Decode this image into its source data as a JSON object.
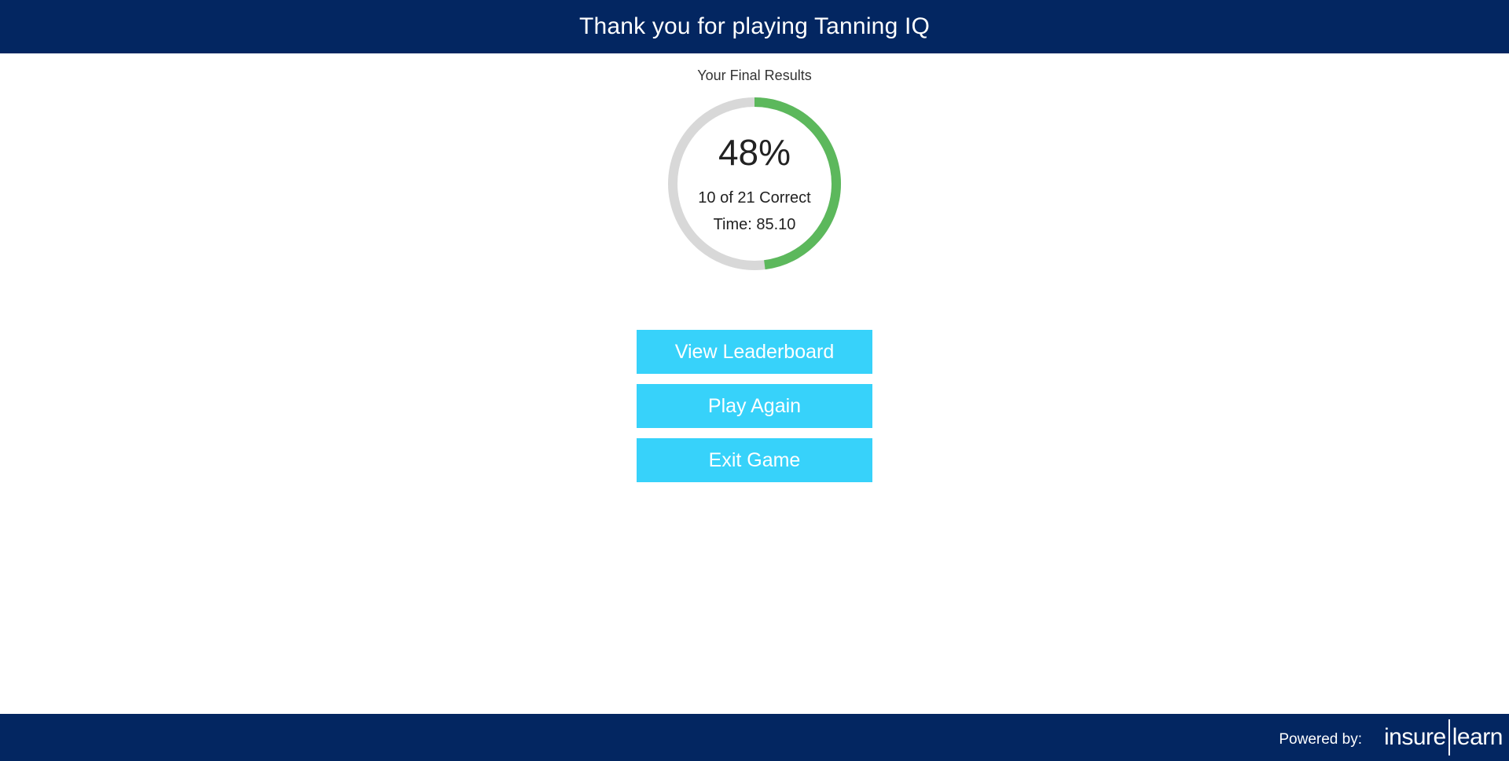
{
  "header": {
    "title": "Thank you for playing Tanning IQ"
  },
  "results": {
    "label": "Your Final Results",
    "percent_text": "48%",
    "progress_fraction": 0.48,
    "correct_text": "10 of 21 Correct",
    "time_text": "Time: 85.10"
  },
  "actions": {
    "leaderboard_label": "View Leaderboard",
    "play_again_label": "Play Again",
    "exit_label": "Exit Game"
  },
  "footer": {
    "powered_by": "Powered by:",
    "logo_left": "insure",
    "logo_right": "learn"
  },
  "colors": {
    "navy": "#032661",
    "button": "#37d2fa",
    "ring_progress": "#5cb85c",
    "ring_track": "#d8d8d8"
  }
}
